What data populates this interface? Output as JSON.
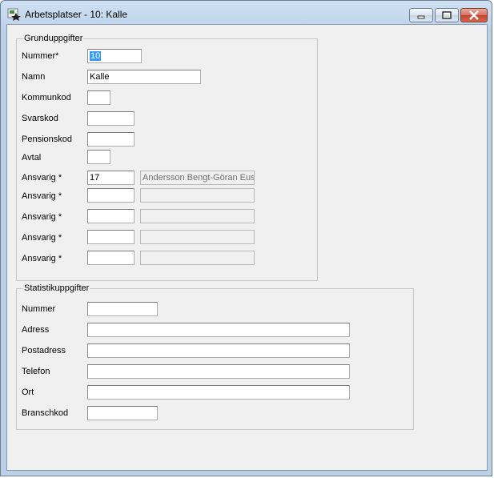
{
  "window": {
    "title": "Arbetsplatser - 10: Kalle"
  },
  "grund": {
    "legend": "Grunduppgifter",
    "fields": {
      "nummer": {
        "label": "Nummer*",
        "value": "10"
      },
      "namn": {
        "label": "Namn",
        "value": "Kalle"
      },
      "kommunkod": {
        "label": "Kommunkod",
        "value": ""
      },
      "svarskod": {
        "label": "Svarskod",
        "value": ""
      },
      "pensionskod": {
        "label": "Pensionskod",
        "value": ""
      },
      "avtal": {
        "label": "Avtal",
        "value": ""
      }
    },
    "ansvarig": [
      {
        "label": "Ansvarig *",
        "code": "17",
        "name": "Andersson Bengt-Göran Euse"
      },
      {
        "label": "Ansvarig *",
        "code": "",
        "name": ""
      },
      {
        "label": "Ansvarig *",
        "code": "",
        "name": ""
      },
      {
        "label": "Ansvarig *",
        "code": "",
        "name": ""
      },
      {
        "label": "Ansvarig *",
        "code": "",
        "name": ""
      }
    ]
  },
  "statistik": {
    "legend": "Statistikuppgifter",
    "fields": {
      "nummer": {
        "label": "Nummer",
        "value": ""
      },
      "adress": {
        "label": "Adress",
        "value": ""
      },
      "postadress": {
        "label": "Postadress",
        "value": ""
      },
      "telefon": {
        "label": "Telefon",
        "value": ""
      },
      "ort": {
        "label": "Ort",
        "value": ""
      },
      "branschkod": {
        "label": "Branschkod",
        "value": ""
      }
    }
  },
  "icons": {
    "app": "app-icon",
    "minimize": "minimize-icon",
    "maximize": "maximize-icon",
    "close": "close-icon"
  },
  "colors": {
    "selection": "#3399ff",
    "close_button": "#c5412a"
  }
}
